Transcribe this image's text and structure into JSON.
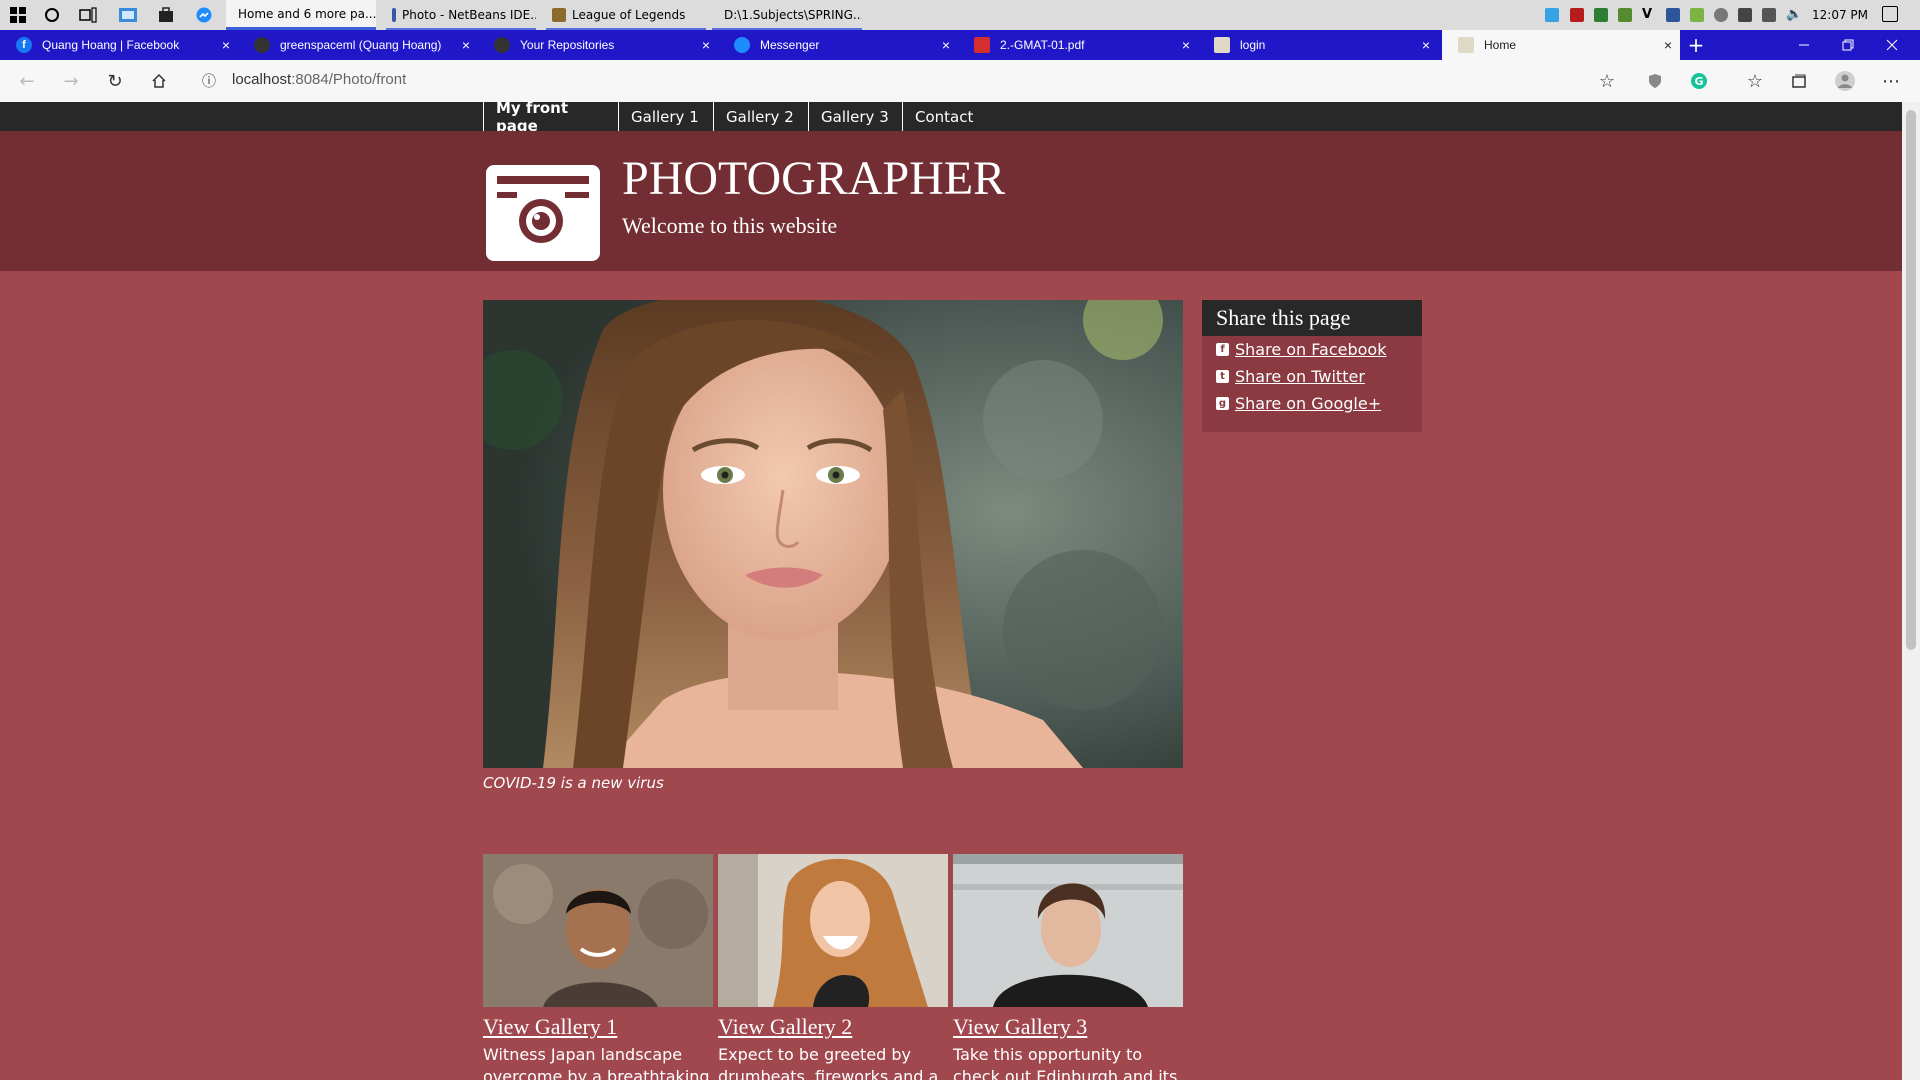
{
  "taskbar": {
    "windows": [
      {
        "label": "Home and 6 more pa...",
        "icon": "edge-icon",
        "active": true
      },
      {
        "label": "Photo - NetBeans IDE...",
        "icon": "netbeans-icon"
      },
      {
        "label": "League of Legends",
        "icon": "league-icon"
      },
      {
        "label": "D:\\1.Subjects\\SPRING...",
        "icon": "folder-icon"
      }
    ],
    "clock": "12:07 PM"
  },
  "browser": {
    "tabs": [
      {
        "label": "Quang Hoang | Facebook",
        "fav_letter": "f",
        "fav_color": "#1877f2"
      },
      {
        "label": "greenspaceml (Quang Hoang)",
        "fav_letter": "",
        "fav_color": "#333333"
      },
      {
        "label": "Your Repositories",
        "fav_letter": "",
        "fav_color": "#333333"
      },
      {
        "label": "Messenger",
        "fav_letter": "",
        "fav_color": "#1e8cff"
      },
      {
        "label": "2.-GMAT-01.pdf",
        "fav_letter": "",
        "fav_color": "#d32f2f"
      },
      {
        "label": "login",
        "fav_letter": "",
        "fav_color": "#bbbbbb"
      },
      {
        "label": "Home",
        "fav_letter": "",
        "fav_color": "#bbbbbb",
        "active": true
      }
    ],
    "close_glyph": "×",
    "new_tab": "+",
    "url_host": "localhost",
    "url_path": ":8084/Photo/front"
  },
  "site": {
    "nav": [
      "My front page",
      "Gallery 1",
      "Gallery 2",
      "Gallery 3",
      "Contact"
    ],
    "title": "PHOTOGRAPHER",
    "tagline": "Welcome to this website",
    "hero_caption": "COVID-19 is a new virus",
    "share": {
      "title": "Share this page",
      "links": [
        "Share on Facebook",
        "Share on Twitter",
        "Share on Google+"
      ]
    },
    "galleries": [
      {
        "link": "View Gallery 1",
        "desc": "Witness Japan landscape overcome by a breathtaking"
      },
      {
        "link": "View Gallery 2",
        "desc": "Expect to be greeted by drumbeats, fireworks and a"
      },
      {
        "link": "View Gallery 3",
        "desc": "Take this opportunity to check out Edinburgh and its many"
      }
    ],
    "colors": {
      "page_bg": "#a0484e",
      "masthead": "#722e33",
      "nav_bg": "#282828"
    }
  }
}
